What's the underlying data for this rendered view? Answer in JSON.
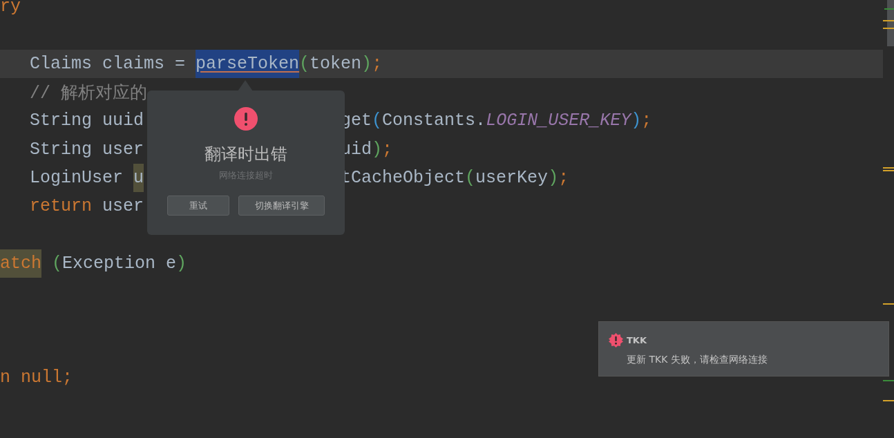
{
  "editor": {
    "lines": [
      {
        "kind": "code",
        "current": false,
        "left": [
          {
            "text": "ry",
            "kind": "keyword"
          }
        ],
        "children": [
          {
            "kind": "blank"
          },
          {
            "kind": "code",
            "current": true,
            "left": [
              {
                "text": "Claims claims = ",
                "kind": "plain"
              },
              {
                "text": "parseToken",
                "kind": "plain",
                "selected": true
              },
              {
                "text": "(",
                "kind": "bracket",
                "color": "#5fa55f"
              },
              {
                "text": "token",
                "kind": "plain"
              },
              {
                "text": ")",
                "kind": "bracket",
                "color": "#5fa55f"
              },
              {
                "text": ";",
                "kind": "keyword"
              }
            ]
          },
          {
            "kind": "code",
            "current": false,
            "left": [
              {
                "text": "// 解析对应的",
                "kind": "comment"
              }
            ]
          },
          {
            "kind": "code",
            "current": false,
            "left": [
              {
                "text": "String uuid",
                "kind": "plain"
              }
            ],
            "right": [
              {
                "text": "get",
                "kind": "plain"
              },
              {
                "text": "(",
                "kind": "bracket",
                "color": "#3d93cf"
              },
              {
                "text": "Constants.",
                "kind": "plain"
              },
              {
                "text": "LOGIN_USER_KEY",
                "kind": "constant"
              },
              {
                "text": ")",
                "kind": "bracket",
                "color": "#3d93cf"
              },
              {
                "text": ";",
                "kind": "keyword"
              }
            ]
          },
          {
            "kind": "code",
            "current": false,
            "left": [
              {
                "text": "String user",
                "kind": "plain"
              }
            ],
            "right": [
              {
                "text": "uid",
                "kind": "plain"
              },
              {
                "text": ")",
                "kind": "bracket",
                "color": "#5fa55f"
              },
              {
                "text": ";",
                "kind": "keyword"
              }
            ]
          },
          {
            "kind": "code",
            "current": false,
            "left": [
              {
                "text": "LoginUser ",
                "kind": "plain"
              },
              {
                "text": "u",
                "kind": "plain",
                "highlighted": true
              }
            ],
            "right": [
              {
                "text": "tCacheObject",
                "kind": "plain"
              },
              {
                "text": "(",
                "kind": "bracket",
                "color": "#5fa55f"
              },
              {
                "text": "userKey",
                "kind": "plain"
              },
              {
                "text": ")",
                "kind": "bracket",
                "color": "#5fa55f"
              },
              {
                "text": ";",
                "kind": "keyword"
              }
            ]
          },
          {
            "kind": "code",
            "current": false,
            "left": [
              {
                "text": "return",
                "kind": "keyword"
              },
              {
                "text": " user",
                "kind": "plain"
              }
            ]
          }
        ]
      },
      {
        "kind": "blank"
      },
      {
        "kind": "code",
        "current": false,
        "left": [
          {
            "text": "atch",
            "kind": "keyword",
            "highlighted": true
          },
          {
            "text": " (",
            "kind": "bracket",
            "color": "#5fa55f"
          },
          {
            "text": "Exception e",
            "kind": "plain"
          },
          {
            "text": ")",
            "kind": "bracket",
            "color": "#5fa55f"
          }
        ]
      },
      {
        "kind": "blank"
      },
      {
        "kind": "blank"
      },
      {
        "kind": "blank"
      },
      {
        "kind": "code",
        "current": false,
        "left": [
          {
            "text": "n null;",
            "kind": "keyword"
          }
        ]
      }
    ]
  },
  "translation_popup": {
    "title": "翻译时出错",
    "message": "网络连接超时",
    "buttons": [
      "重试",
      "切换翻译引擎"
    ]
  },
  "notification": {
    "title": "TKK",
    "message": "更新 TKK 失败，请检查网络连接"
  }
}
